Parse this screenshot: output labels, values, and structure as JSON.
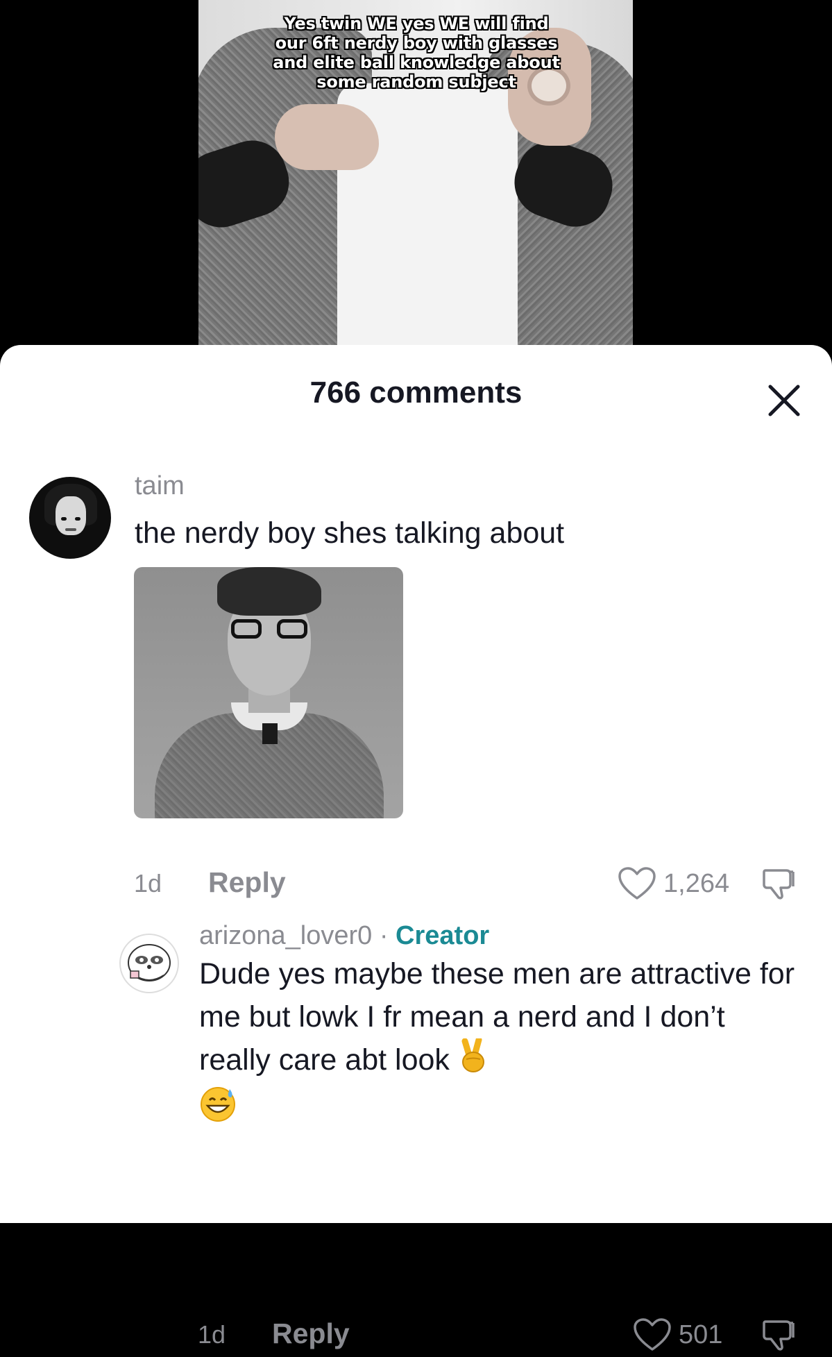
{
  "video": {
    "caption": "Yes twin WE yes WE will find our 6ft nerdy boy with glasses and elite ball knowledge about some random subject"
  },
  "sheet": {
    "title": "766 comments",
    "close_icon": "close-icon"
  },
  "comments": [
    {
      "username": "taim",
      "text": "the nerdy boy shes talking about",
      "time": "1d",
      "reply_label": "Reply",
      "likes": "1,264",
      "has_image": true
    },
    {
      "username": "arizona_lover0",
      "separator": " · ",
      "badge": "Creator",
      "text": "Dude yes maybe these men are attractive for me but lowk I fr mean a nerd and I don’t really care abt look",
      "emojis": [
        "victory-hand-emoji",
        "grinning-sweat-emoji"
      ],
      "time": "1d",
      "reply_label": "Reply",
      "likes": "501"
    }
  ],
  "colors": {
    "accent_creator": "#1b8a94",
    "secondary_text": "#8a8b91",
    "primary_text": "#161823"
  }
}
